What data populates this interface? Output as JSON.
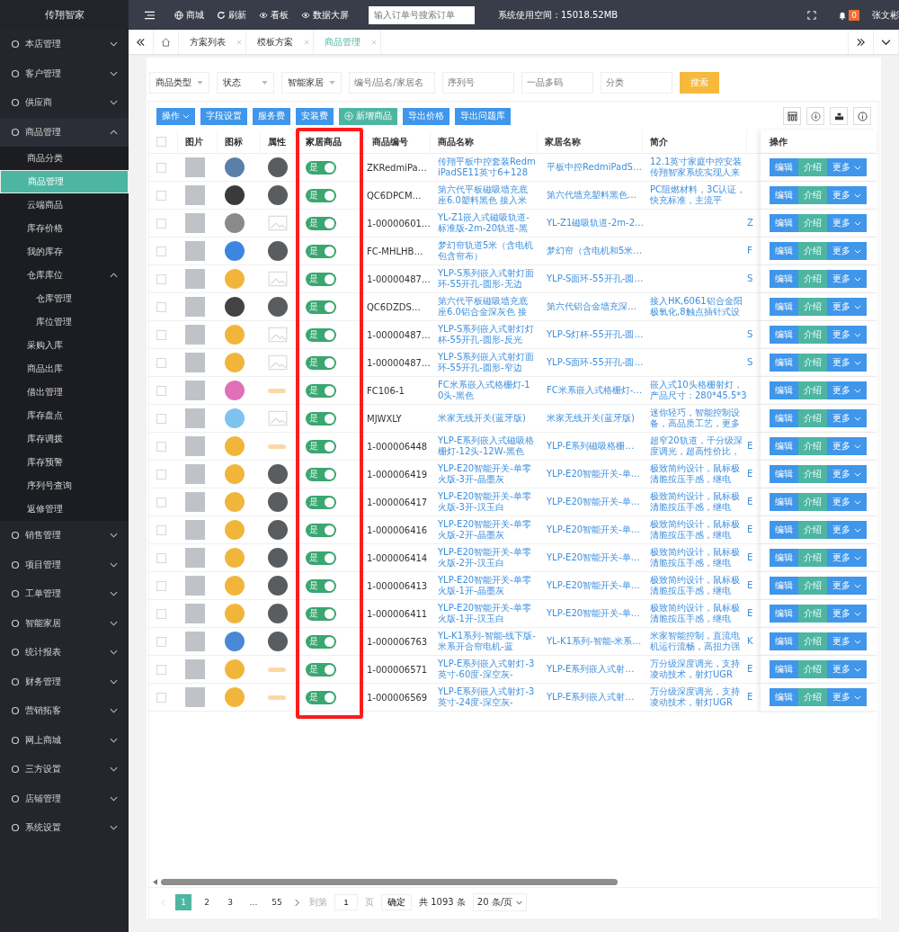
{
  "sidebar": {
    "logo": "传翔智家",
    "items": [
      {
        "label": "本店管理",
        "expanded": false,
        "selected": false
      },
      {
        "label": "客户管理",
        "expanded": false,
        "selected": false
      },
      {
        "label": "供应商",
        "expanded": false,
        "selected": false
      },
      {
        "label": "商品管理",
        "expanded": true,
        "selected": false,
        "children": [
          {
            "label": "商品分类",
            "selected": false
          },
          {
            "label": "商品管理",
            "selected": true
          },
          {
            "label": "云端商品",
            "selected": false
          },
          {
            "label": "库存价格",
            "selected": false
          },
          {
            "label": "我的库存",
            "selected": false
          },
          {
            "label": "仓库库位",
            "expanded": true,
            "selected": false,
            "children": [
              {
                "label": "仓库管理",
                "selected": false
              },
              {
                "label": "库位管理",
                "selected": false
              }
            ]
          },
          {
            "label": "采购入库",
            "selected": false
          },
          {
            "label": "商品出库",
            "selected": false
          },
          {
            "label": "借出管理",
            "selected": false
          },
          {
            "label": "库存盘点",
            "selected": false
          },
          {
            "label": "库存调拨",
            "selected": false
          },
          {
            "label": "库存预警",
            "selected": false
          },
          {
            "label": "序列号查询",
            "selected": false
          },
          {
            "label": "返修管理",
            "selected": false
          }
        ]
      },
      {
        "label": "销售管理",
        "expanded": false,
        "selected": false
      },
      {
        "label": "项目管理",
        "expanded": false,
        "selected": false
      },
      {
        "label": "工单管理",
        "expanded": false,
        "selected": false
      },
      {
        "label": "智能家居",
        "expanded": false,
        "selected": false
      },
      {
        "label": "统计报表",
        "expanded": false,
        "selected": false
      },
      {
        "label": "财务管理",
        "expanded": false,
        "selected": false
      },
      {
        "label": "营销拓客",
        "expanded": false,
        "selected": false
      },
      {
        "label": "网上商城",
        "expanded": false,
        "selected": false
      },
      {
        "label": "三方设置",
        "expanded": false,
        "selected": false
      },
      {
        "label": "店铺管理",
        "expanded": false,
        "selected": false
      },
      {
        "label": "系统设置",
        "expanded": false,
        "selected": false
      }
    ]
  },
  "topbar": {
    "nav": [
      {
        "label": "商城"
      },
      {
        "label": "刷新"
      },
      {
        "label": "看板"
      },
      {
        "label": "数据大屏"
      }
    ],
    "search": {
      "placeholder": "输入订单号搜索订单"
    },
    "storage": "系统使用空间：15018.52MB",
    "badge": "0",
    "user": "张文彬"
  },
  "tabs": [
    {
      "label": "方案列表",
      "selected": false
    },
    {
      "label": "模板方案",
      "selected": false
    },
    {
      "label": "商品管理",
      "selected": true
    }
  ],
  "filters": {
    "selects": [
      "商品类型",
      "状态",
      "智能家居"
    ],
    "placeholders": [
      "编号/品名/家居名",
      "序列号",
      "一品多码",
      "分类"
    ],
    "search_button": "搜索"
  },
  "toolbar": {
    "buttons": [
      {
        "label": "操作",
        "kind": "dropdown"
      },
      {
        "label": "字段设置",
        "kind": "plain"
      },
      {
        "label": "服务费",
        "kind": "plain"
      },
      {
        "label": "安装费",
        "kind": "plain"
      },
      {
        "label": "新增商品",
        "kind": "add"
      },
      {
        "label": "导出价格",
        "kind": "plain"
      },
      {
        "label": "导出问题库",
        "kind": "plain"
      }
    ]
  },
  "table": {
    "select_all": {
      "checked": false
    },
    "columns": [
      {
        "label": "图片",
        "highlighted": false
      },
      {
        "label": "图标",
        "highlighted": false
      },
      {
        "label": "属性",
        "highlighted": false
      },
      {
        "label": "家居商品",
        "highlighted": true
      },
      {
        "label": "商品编号",
        "highlighted": false
      },
      {
        "label": "商品名称",
        "highlighted": false
      },
      {
        "label": "家居名称",
        "highlighted": false
      },
      {
        "label": "简介",
        "highlighted": false
      },
      {
        "label": "操作",
        "highlighted": false
      }
    ],
    "rows": [
      {
        "checked": false,
        "color": "#5b7fa8",
        "attribute": {
          "kind": "photo"
        },
        "home": {
          "on": true,
          "label": "是"
        },
        "code": "ZKRedmiPa…",
        "name": "传翔平板中控套装RedmiPadSE11英寸6+128",
        "home_name": "平板中控RedmiPadS…",
        "intro": "12.1英寸家庭中控安装传翔智家系统实现人来",
        "actions": [
          "编辑",
          "介绍",
          "更多"
        ]
      },
      {
        "checked": false,
        "color": "#3a3a3a",
        "attribute": {
          "kind": "photo"
        },
        "home": {
          "on": true,
          "label": "是"
        },
        "code": "QC6DPCM…",
        "name": "第六代平板磁吸墙充底座6.0塑料黑色 接入米",
        "home_name": "第六代墙充塑料黑色…",
        "intro": "PC阻燃材料，3C认证，快充标准，主流平",
        "actions": [
          "编辑",
          "介绍",
          "更多"
        ]
      },
      {
        "checked": false,
        "color": "#8a8a8a",
        "attribute": {
          "kind": "empty"
        },
        "home": {
          "on": true,
          "label": "是"
        },
        "code": "1-00000601…",
        "name": "YL-Z1嵌入式磁吸轨道-标准版-2m-20轨道-黑",
        "home_name": "YL-Z1磁吸轨道-2m-2…",
        "column_10": "Z",
        "actions": [
          "编辑",
          "介绍",
          "更多"
        ]
      },
      {
        "checked": false,
        "color": "#3d86e0",
        "attribute": {
          "kind": "photo"
        },
        "home": {
          "on": true,
          "label": "是"
        },
        "code": "FC-MHLHB…",
        "name": "梦幻帘轨道5米（含电机包含帘布）",
        "home_name": "梦幻帘（含电机和5米…",
        "column_10": "F",
        "actions": [
          "编辑",
          "介绍",
          "更多"
        ]
      },
      {
        "checked": false,
        "color": "#f2b53c",
        "attribute": {
          "kind": "empty"
        },
        "home": {
          "on": true,
          "label": "是"
        },
        "code": "1-00000487…",
        "name": "YLP-S系列嵌入式射灯面环-55开孔-圆形-无边",
        "home_name": "YLP-S面环-55开孔-圆…",
        "column_10": "S",
        "actions": [
          "编辑",
          "介绍",
          "更多"
        ]
      },
      {
        "checked": false,
        "color": "#444444",
        "attribute": {
          "kind": "photo"
        },
        "home": {
          "on": true,
          "label": "是"
        },
        "code": "QC6DZDS…",
        "name": "第六代平板磁吸墙充底座6.0铝合金深灰色 接",
        "home_name": "第六代铝合金墙充深…",
        "intro": "接入HK,6061铝合金阳极氧化,8触点插针式设",
        "actions": [
          "编辑",
          "介绍",
          "更多"
        ]
      },
      {
        "checked": false,
        "color": "#f2b53c",
        "attribute": {
          "kind": "empty"
        },
        "home": {
          "on": true,
          "label": "是"
        },
        "code": "1-00000487…",
        "name": "YLP-S系列嵌入式射灯灯杯-55开孔-圆形-反光",
        "home_name": "YLP-S灯杯-55开孔-圆…",
        "column_10": "S",
        "actions": [
          "编辑",
          "介绍",
          "更多"
        ]
      },
      {
        "checked": false,
        "color": "#f2b53c",
        "attribute": {
          "kind": "empty"
        },
        "home": {
          "on": true,
          "label": "是"
        },
        "code": "1-00000487…",
        "name": "YLP-S系列嵌入式射灯面环-55开孔-圆形-窄边",
        "home_name": "YLP-S面环-55开孔-圆…",
        "column_10": "S",
        "actions": [
          "编辑",
          "介绍",
          "更多"
        ]
      },
      {
        "checked": false,
        "color": "#e070b8",
        "attribute": {
          "kind": "glow"
        },
        "home": {
          "on": true,
          "label": "是"
        },
        "code": "FC106-1",
        "name": "FC米系嵌入式格栅灯-10头-黑色",
        "home_name": "FC米系嵌入式格栅灯-…",
        "intro": "嵌入式10头格栅射灯，产品尺寸：280*45.5*3",
        "actions": [
          "编辑",
          "介绍",
          "更多"
        ]
      },
      {
        "checked": false,
        "color": "#7ec3f0",
        "attribute": {
          "kind": "empty"
        },
        "home": {
          "on": true,
          "label": "是"
        },
        "code": "MJWXLY",
        "name": "米家无线开关(蓝牙版)",
        "home_name": "米家无线开关(蓝牙版)",
        "intro": "迷你轻巧，智能控制设备，高品质工艺，更多",
        "actions": [
          "编辑",
          "介绍",
          "更多"
        ]
      },
      {
        "checked": false,
        "color": "#f2b53c",
        "attribute": {
          "kind": "glow"
        },
        "home": {
          "on": true,
          "label": "是"
        },
        "code": "1-000006448",
        "name": "YLP-E系列嵌入式磁吸格栅灯-12头-12W-黑色",
        "home_name": "YLP-E系列磁吸格栅…",
        "intro": "超窄20轨道，千分级深度调光，超高性价比，",
        "column_10": "E",
        "actions": [
          "编辑",
          "介绍",
          "更多"
        ]
      },
      {
        "checked": false,
        "color": "#f2b53c",
        "attribute": {
          "kind": "photo"
        },
        "home": {
          "on": true,
          "label": "是"
        },
        "code": "1-000006419",
        "name": "YLP-E20智能开关-单零火版-3开-晶墨灰",
        "home_name": "YLP-E20智能开关-单…",
        "intro": "极致简约设计，鼠标极清脆按压手感，继电",
        "column_10": "E",
        "actions": [
          "编辑",
          "介绍",
          "更多"
        ]
      },
      {
        "checked": false,
        "color": "#f2b53c",
        "attribute": {
          "kind": "photo"
        },
        "home": {
          "on": true,
          "label": "是"
        },
        "code": "1-000006417",
        "name": "YLP-E20智能开关-单零火版-3开-汉玉白",
        "home_name": "YLP-E20智能开关-单…",
        "intro": "极致简约设计，鼠标极清脆按压手感，继电",
        "column_10": "E",
        "actions": [
          "编辑",
          "介绍",
          "更多"
        ]
      },
      {
        "checked": false,
        "color": "#f2b53c",
        "attribute": {
          "kind": "photo"
        },
        "home": {
          "on": true,
          "label": "是"
        },
        "code": "1-000006416",
        "name": "YLP-E20智能开关-单零火版-2开-晶墨灰",
        "home_name": "YLP-E20智能开关-单…",
        "intro": "极致简约设计，鼠标极清脆按压手感，继电",
        "column_10": "E",
        "actions": [
          "编辑",
          "介绍",
          "更多"
        ]
      },
      {
        "checked": false,
        "color": "#f2b53c",
        "attribute": {
          "kind": "photo"
        },
        "home": {
          "on": true,
          "label": "是"
        },
        "code": "1-000006414",
        "name": "YLP-E20智能开关-单零火版-2开-汉玉白",
        "home_name": "YLP-E20智能开关-单…",
        "intro": "极致简约设计，鼠标极清脆按压手感，继电",
        "column_10": "E",
        "actions": [
          "编辑",
          "介绍",
          "更多"
        ]
      },
      {
        "checked": false,
        "color": "#f2b53c",
        "attribute": {
          "kind": "photo"
        },
        "home": {
          "on": true,
          "label": "是"
        },
        "code": "1-000006413",
        "name": "YLP-E20智能开关-单零火版-1开-晶墨灰",
        "home_name": "YLP-E20智能开关-单…",
        "intro": "极致简约设计，鼠标极清脆按压手感，继电",
        "column_10": "E",
        "actions": [
          "编辑",
          "介绍",
          "更多"
        ]
      },
      {
        "checked": false,
        "color": "#f2b53c",
        "attribute": {
          "kind": "photo"
        },
        "home": {
          "on": true,
          "label": "是"
        },
        "code": "1-000006411",
        "name": "YLP-E20智能开关-单零火版-1开-汉玉白",
        "home_name": "YLP-E20智能开关-单…",
        "intro": "极致简约设计，鼠标极清脆按压手感，继电",
        "column_10": "E",
        "actions": [
          "编辑",
          "介绍",
          "更多"
        ]
      },
      {
        "checked": false,
        "color": "#4a88d6",
        "attribute": {
          "kind": "photo"
        },
        "home": {
          "on": true,
          "label": "是"
        },
        "code": "1-000006763",
        "name": "YL-K1系列-智能-线下版-米系开合帘电机-蓝",
        "home_name": "YL-K1系列-智能-米系…",
        "intro": "米家智能控制，直流电机运行流畅，高扭力强",
        "column_10": "K",
        "actions": [
          "编辑",
          "介绍",
          "更多"
        ]
      },
      {
        "checked": false,
        "color": "#f2b53c",
        "attribute": {
          "kind": "glow"
        },
        "home": {
          "on": true,
          "label": "是"
        },
        "code": "1-000006571",
        "name": "YLP-E系列嵌入式射灯-3英寸-60度-深空灰-",
        "home_name": "YLP-E系列嵌入式射…",
        "intro": "万分级深度调光，支持凌动技术，射灯UGR",
        "column_10": "E",
        "actions": [
          "编辑",
          "介绍",
          "更多"
        ]
      },
      {
        "checked": false,
        "color": "#f2b53c",
        "attribute": {
          "kind": "glow"
        },
        "home": {
          "on": true,
          "label": "是"
        },
        "code": "1-000006569",
        "name": "YLP-E系列嵌入式射灯-3英寸-24度-深空灰-",
        "home_name": "YLP-E系列嵌入式射…",
        "intro": "万分级深度调光，支持凌动技术，射灯UGR",
        "column_10": "E",
        "actions": [
          "编辑",
          "介绍",
          "更多"
        ]
      }
    ]
  },
  "pagination": {
    "pages": [
      {
        "label": "1",
        "selected": true
      },
      {
        "label": "2",
        "selected": false
      },
      {
        "label": "3",
        "selected": false
      },
      {
        "label": "…",
        "selected": false
      },
      {
        "label": "55",
        "selected": false
      }
    ],
    "goto_label": "到第",
    "goto_value": "1",
    "page_unit": "页",
    "confirm": "确定",
    "total": "共 1093 条",
    "page_size": "20 条/页"
  }
}
